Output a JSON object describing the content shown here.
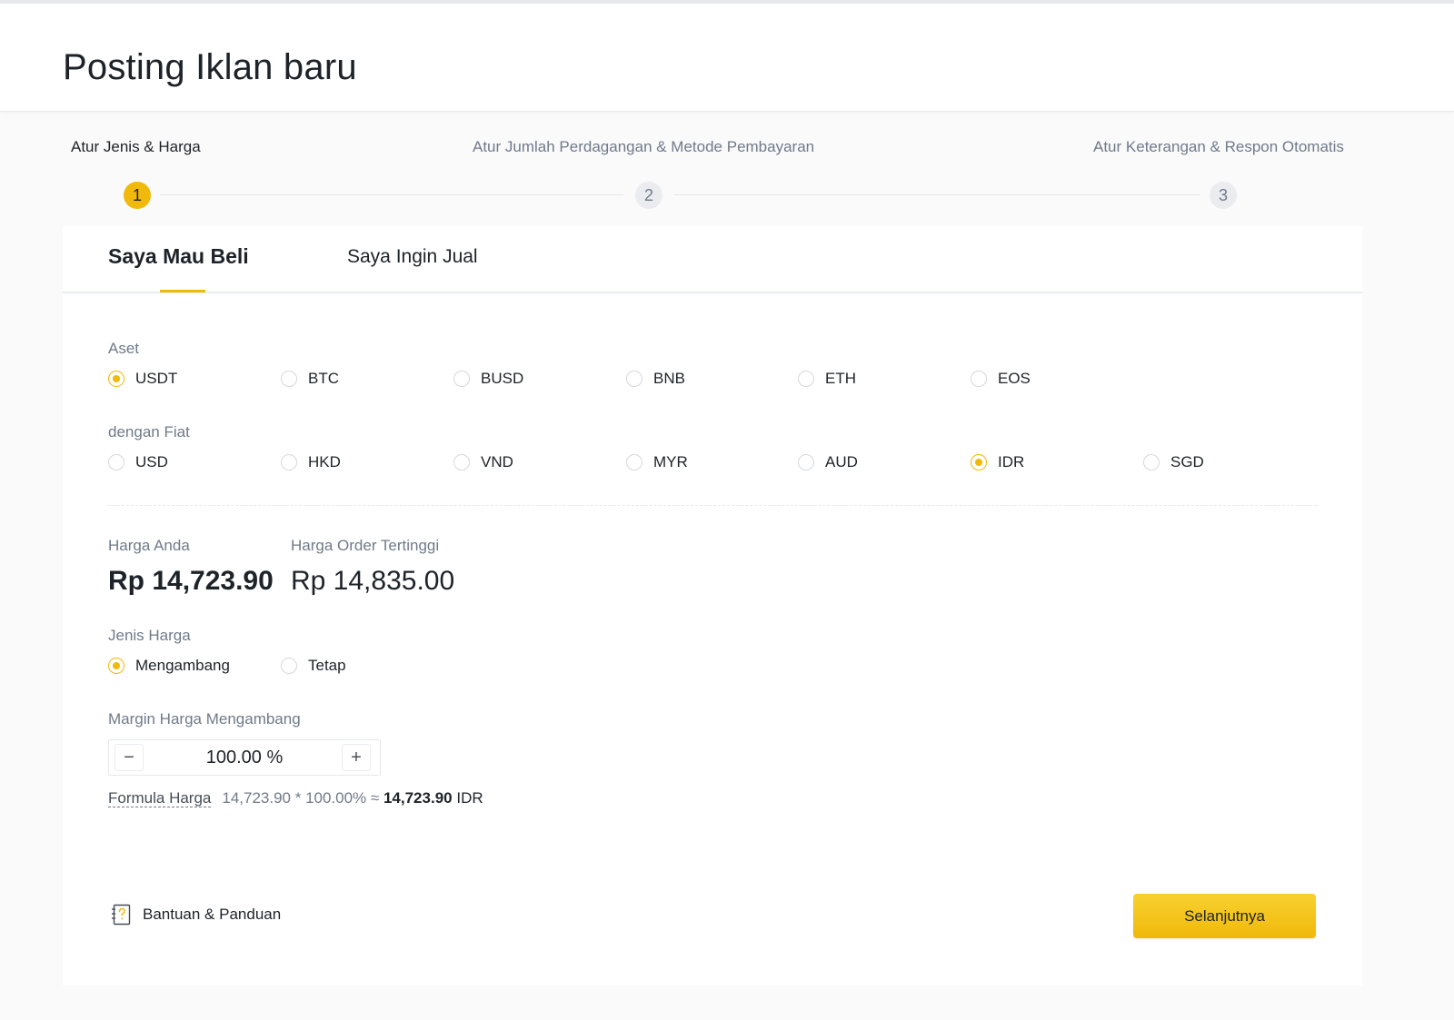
{
  "page": {
    "title": "Posting Iklan baru"
  },
  "steps": [
    {
      "number": "1",
      "label": "Atur Jenis & Harga",
      "active": true
    },
    {
      "number": "2",
      "label": "Atur Jumlah Perdagangan & Metode Pembayaran",
      "active": false
    },
    {
      "number": "3",
      "label": "Atur Keterangan & Respon Otomatis",
      "active": false
    }
  ],
  "tabs": {
    "buy": "Saya Mau Beli",
    "sell": "Saya Ingin Jual",
    "selected": "buy"
  },
  "asset": {
    "label": "Aset",
    "options": [
      "USDT",
      "BTC",
      "BUSD",
      "BNB",
      "ETH",
      "EOS"
    ],
    "selected": "USDT"
  },
  "fiat": {
    "label": "dengan Fiat",
    "options": [
      "USD",
      "HKD",
      "VND",
      "MYR",
      "AUD",
      "IDR",
      "SGD"
    ],
    "selected": "IDR"
  },
  "prices": {
    "your_price_label": "Harga Anda",
    "your_price": "Rp 14,723.90",
    "highest_label": "Harga Order Tertinggi",
    "highest_price": "Rp 14,835.00"
  },
  "price_type": {
    "label": "Jenis Harga",
    "options": [
      "Mengambang",
      "Tetap"
    ],
    "selected": "Mengambang"
  },
  "margin": {
    "label": "Margin Harga Mengambang",
    "value": "100.00 %",
    "minus": "−",
    "plus": "+"
  },
  "formula": {
    "label": "Formula Harga",
    "expression": "14,723.90 * 100.00% ≈",
    "result": "14,723.90",
    "currency": "IDR"
  },
  "help": {
    "label": "Bantuan & Panduan",
    "icon": "help-guide-icon"
  },
  "next_button": {
    "label": "Selanjutnya"
  },
  "colors": {
    "accent": "#f0b90b",
    "text": "#1e2329",
    "muted": "#707a8a"
  }
}
